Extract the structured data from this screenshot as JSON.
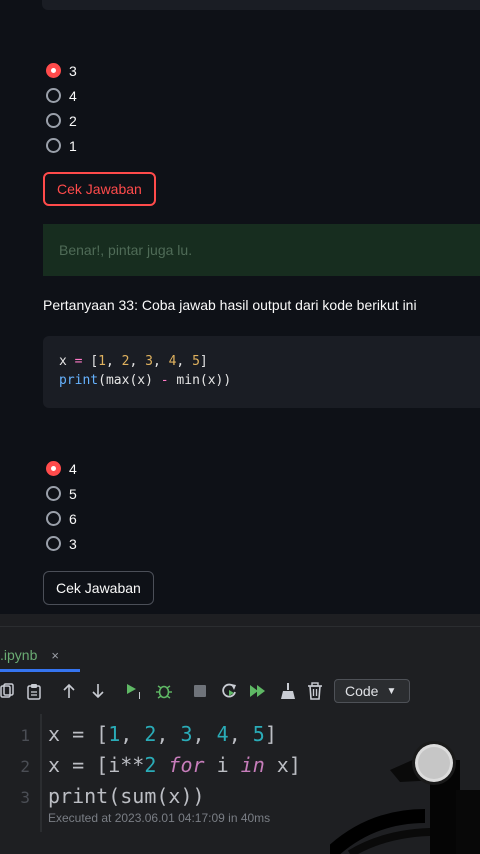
{
  "question_prev": {
    "options": [
      "3",
      "4",
      "2",
      "1"
    ],
    "selected_index": 0,
    "button_label": "Cek Jawaban",
    "feedback": "Benar!, pintar juga lu."
  },
  "question_33": {
    "title": "Pertanyaan 33: Coba jawab hasil output dari kode berikut ini",
    "code_line1": {
      "var": "x",
      "op": "=",
      "open": "[",
      "n1": "1",
      "n2": "2",
      "n3": "3",
      "n4": "4",
      "n5": "5",
      "close": "]"
    },
    "code_line2": {
      "fn": "print",
      "open": "(",
      "max": "max",
      "arg1": "(x)",
      "minus": "-",
      "min": "min",
      "arg2": "(x))"
    },
    "options": [
      "4",
      "5",
      "6",
      "3"
    ],
    "selected_index": 0,
    "button_label": "Cek Jawaban"
  },
  "ide": {
    "tab_name": ".ipynb",
    "tab_close": "×",
    "cell_type_label": "Code",
    "gutter": [
      "1",
      "2",
      "3"
    ],
    "line1": {
      "a": "x = [",
      "n1": "1",
      "c1": ", ",
      "n2": "2",
      "c2": ", ",
      "n3": "3",
      "c3": ", ",
      "n4": "4",
      "c4": ", ",
      "n5": "5",
      "end": "]"
    },
    "line2": {
      "a": "x = [i**",
      "n": "2",
      "sp": " ",
      "kw1": "for",
      "mid": " i ",
      "kw2": "in",
      "end": " x]"
    },
    "line3": "print(sum(x))",
    "executed": "Executed at 2023.06.01 04:17:09 in 40ms"
  },
  "colors": {
    "accent_red": "#ff4b4b",
    "success_bg": "#172d1f",
    "ide_bg": "#1e1f22",
    "app_bg": "#0e1117"
  }
}
